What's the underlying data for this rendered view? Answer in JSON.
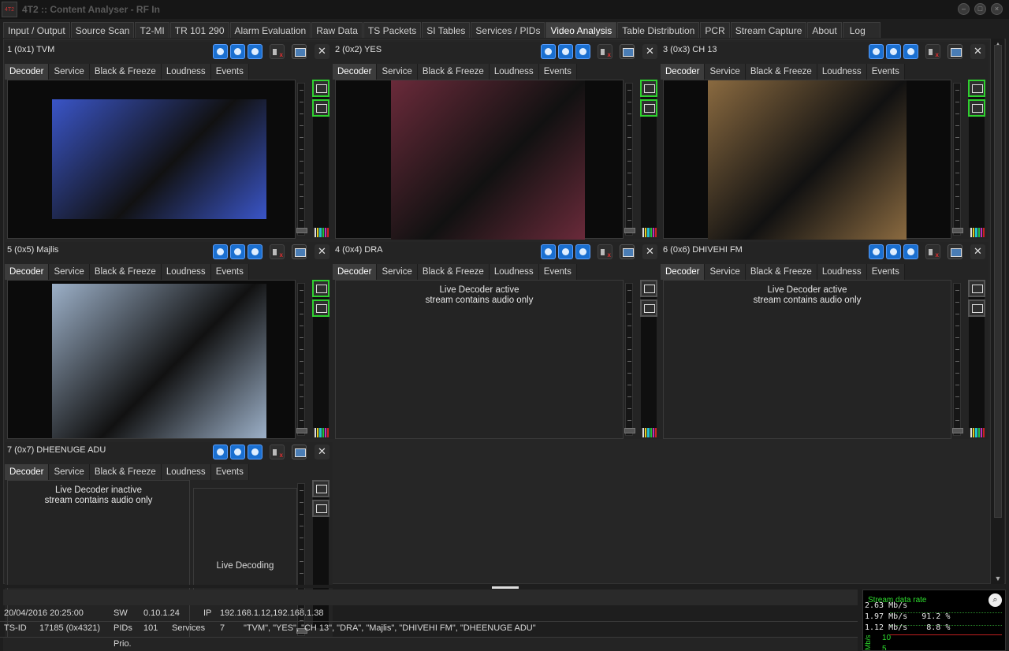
{
  "window": {
    "logo_text": "4T2",
    "title": "4T2 :: Content Analyser - RF In"
  },
  "main_tabs": [
    "Input / Output",
    "Source Scan",
    "T2-MI",
    "TR 101 290",
    "Alarm Evaluation",
    "Raw Data",
    "TS Packets",
    "SI Tables",
    "Services / PIDs",
    "Video Analysis",
    "Table Distribution",
    "PCR",
    "Stream Capture",
    "About",
    "Log"
  ],
  "active_main_tab": "Video Analysis",
  "sub_tabs": [
    "Decoder",
    "Service",
    "Black & Freeze",
    "Loudness",
    "Events"
  ],
  "panels": [
    {
      "title": "1 (0x1) TVM",
      "has_video": true,
      "thumb_color": "#3a55c8"
    },
    {
      "title": "2 (0x2) YES",
      "has_video": true,
      "thumb_color": "#6a2a3a"
    },
    {
      "title": "3 (0x3) CH 13",
      "has_video": true,
      "thumb_color": "#8a6a40"
    },
    {
      "title": "5 (0x5) Majlis",
      "has_video": true,
      "thumb_color": "#9cb0c8"
    },
    {
      "title": "4 (0x4) DRA",
      "has_video": false,
      "status_line1": "Live Decoder active",
      "status_line2": "stream contains audio only"
    },
    {
      "title": "6 (0x6) DHIVEHI FM",
      "has_video": false,
      "status_line1": "Live Decoder active",
      "status_line2": "stream contains audio only"
    },
    {
      "title": "7 (0x7) DHEENUGE ADU",
      "has_video": false,
      "status_line1": "Live Decoder inactive",
      "status_line2": "stream contains audio only",
      "inner_label": "Live Decoding"
    }
  ],
  "status": {
    "datetime": "20/04/2016 20:25:00",
    "sw_label": "SW",
    "sw_value": "0.10.1.24",
    "ip_label": "IP",
    "ip_value": "192.168.1.12,192.168.1.38",
    "tsid_label": "TS-ID",
    "tsid_value": "17185 (0x4321)",
    "pids_label": "PIDs",
    "pids_value": "101",
    "services_label": "Services",
    "services_value": "7",
    "services_list": "\"TVM\", \"YES\", \"CH 13\", \"DRA\", \"Majlis\", \"DHIVEHI FM\", \"DHEENUGE ADU\"",
    "prio_label": "Prio."
  },
  "rate_panel": {
    "title": "Stream data rate",
    "row1": "2.63 Mb/s",
    "row2": "1.97 Mb/s   91.2 %",
    "row3": "1.12 Mb/s    8.8 %",
    "y_label": "Mb/s",
    "y_tick_1": "10",
    "y_tick_2": "5"
  },
  "colors": {
    "accent_green": "#2fd02f",
    "button_blue": "#1a6fd0",
    "mute_red": "#e03030"
  }
}
